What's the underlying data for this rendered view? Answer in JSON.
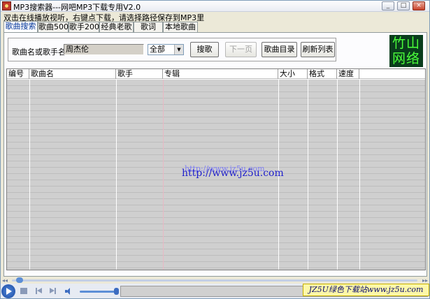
{
  "window": {
    "title": "MP3搜索器---网吧MP3下载专用V2.0",
    "hint": "双击在线播放视听，右键点下载，请选择路径保存到MP3里",
    "controls": {
      "minimize": "_",
      "maximize": "□",
      "close": "×"
    }
  },
  "tabs": [
    {
      "label": "歌曲搜索",
      "active": true
    },
    {
      "label": "歌曲500",
      "active": false
    },
    {
      "label": "歌手200",
      "active": false
    },
    {
      "label": "经典老歌",
      "active": false
    },
    {
      "label": "歌词",
      "active": false
    },
    {
      "label": "本地歌曲",
      "active": false
    }
  ],
  "search": {
    "label": "歌曲名或歌手名",
    "value": "周杰伦",
    "scope_selected": "全部",
    "buttons": {
      "search": "搜歌",
      "next_page": "下一页",
      "catalog": "歌曲目录",
      "refresh": "刷新列表"
    }
  },
  "logo": {
    "line1": "竹山",
    "line2": "网络"
  },
  "table": {
    "columns": [
      "编号",
      "歌曲名",
      "歌手",
      "专辑",
      "大小",
      "格式",
      "速度"
    ]
  },
  "watermark": {
    "main": "http://www.jz5u.com",
    "shadow": "http://www.jz5u.com"
  },
  "player": {
    "seek_left": "◂◂",
    "seek_right": "▸▸"
  },
  "badge": "JZ5U绿色下载站www.jz5u.com",
  "colors": {
    "accent": "#003399",
    "logo_bg": "#0a3d1c",
    "logo_text": "#4bff3a",
    "watermark": "#2020cc"
  }
}
